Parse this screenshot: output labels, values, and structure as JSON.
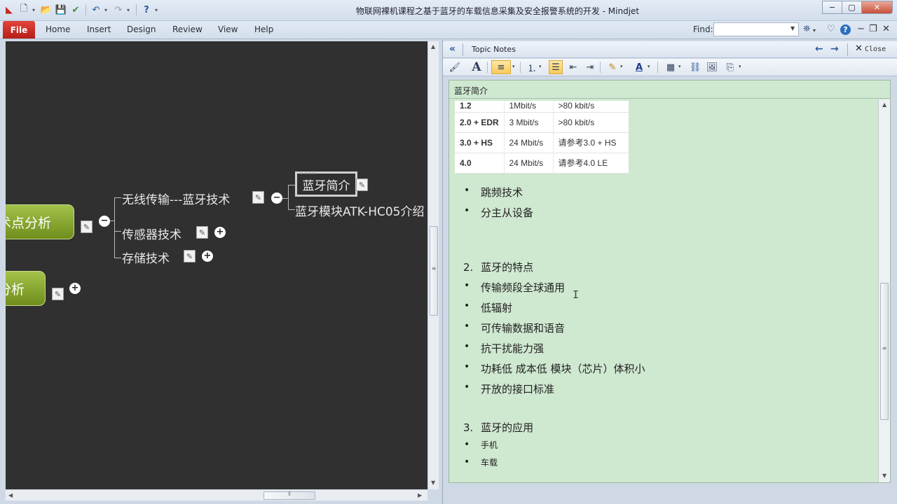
{
  "window": {
    "title": "物联网裸机课程之基于蓝牙的车载信息采集及安全报警系统的开发  - Mindjet",
    "controls": [
      "−",
      "▢",
      "✕"
    ]
  },
  "ribbon": {
    "file": "File",
    "tabs": [
      "Home",
      "Insert",
      "Design",
      "Review",
      "View",
      "Help"
    ],
    "find_label": "Find:",
    "find_value": ""
  },
  "map": {
    "main_topic_1": "术点分析",
    "main_topic_2": "分析",
    "subtopics": [
      "无线传输---蓝牙技术",
      "传感器技术",
      "存储技术"
    ],
    "children": [
      "蓝牙简介",
      "蓝牙模块ATK-HC05介绍"
    ],
    "expand_symbols": {
      "minus": "−",
      "plus": "+"
    }
  },
  "notes": {
    "panel_title": "Topic Notes",
    "close_label": "Close",
    "topic": "蓝牙简介",
    "table": [
      {
        "version": "1.2",
        "rate": "1Mbit/s",
        "effective": ">80 kbit/s"
      },
      {
        "version": "2.0 + EDR",
        "rate": "3 Mbit/s",
        "effective": ">80 kbit/s"
      },
      {
        "version": "3.0 + HS",
        "rate": "24 Mbit/s",
        "effective": "请参考3.0 + HS"
      },
      {
        "version": "4.0",
        "rate": "24 Mbit/s",
        "effective": "请参考4.0 LE"
      }
    ],
    "tech_bullets": [
      "跳频技术",
      "分主从设备"
    ],
    "section2": {
      "number": "2.",
      "heading": "蓝牙的特点"
    },
    "features": [
      "传输频段全球通用",
      "低辐射",
      "可传输数据和语音",
      "抗干扰能力强",
      "功耗低 成本低 模块（芯片）体积小",
      "开放的接口标准"
    ],
    "section3": {
      "number": "3.",
      "heading": "蓝牙的应用"
    },
    "applications": [
      "手机",
      "车载"
    ]
  },
  "colors": {
    "map_background": "#303030",
    "main_topic": "#8aa832",
    "notes_background": "#cfe8d0",
    "file_tab": "#c8281f"
  }
}
